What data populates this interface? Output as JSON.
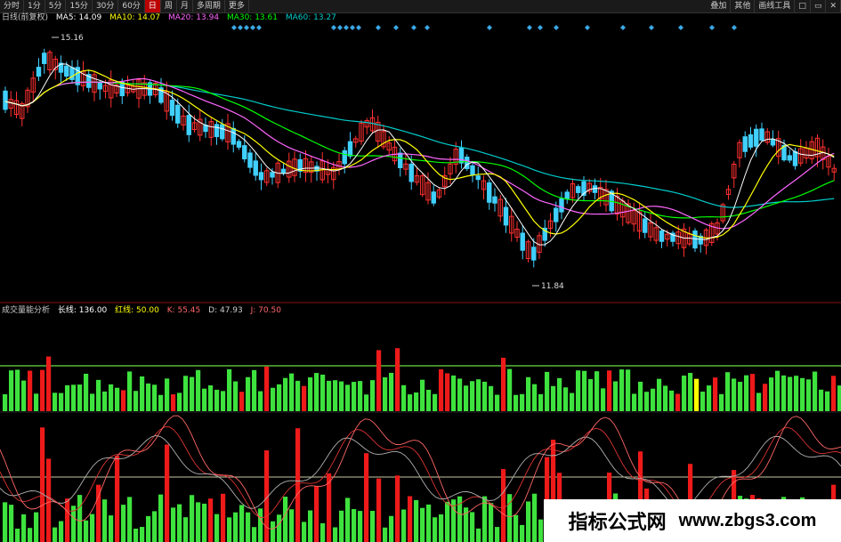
{
  "toolbar": {
    "items": [
      "分时",
      "1分",
      "5分",
      "15分",
      "30分",
      "60分",
      "日",
      "周",
      "月",
      "多周期",
      "更多"
    ],
    "active_index": 6,
    "right_items": [
      "叠加",
      "其他",
      "画线工具",
      "□",
      "▭",
      "✕"
    ]
  },
  "ma_legend": {
    "title": "日线(前复权)",
    "ma5": "MA5: 14.09",
    "ma10": "MA10: 14.07",
    "ma20": "MA20: 13.94",
    "ma30": "MA30: 13.61",
    "ma60": "MA60: 13.27",
    "colors": {
      "ma5": "#ffffff",
      "ma10": "#ffff00",
      "ma20": "#ff66ff",
      "ma30": "#00ff00",
      "ma60": "#00cccc"
    }
  },
  "price_labels": {
    "high": "15.16",
    "low": "11.84"
  },
  "indicator_legend": {
    "name": "成交量能分析",
    "long": "长线: 136.00",
    "red": "红线: 50.00",
    "k": "K: 55.45",
    "d": "D: 47.93",
    "j": "J: 70.50"
  },
  "watermark": {
    "cn": "指标公式网",
    "url": "www.zbgs3.com"
  },
  "chart_data": {
    "type": "candlestick",
    "low": 11.84,
    "high": 15.16
  }
}
